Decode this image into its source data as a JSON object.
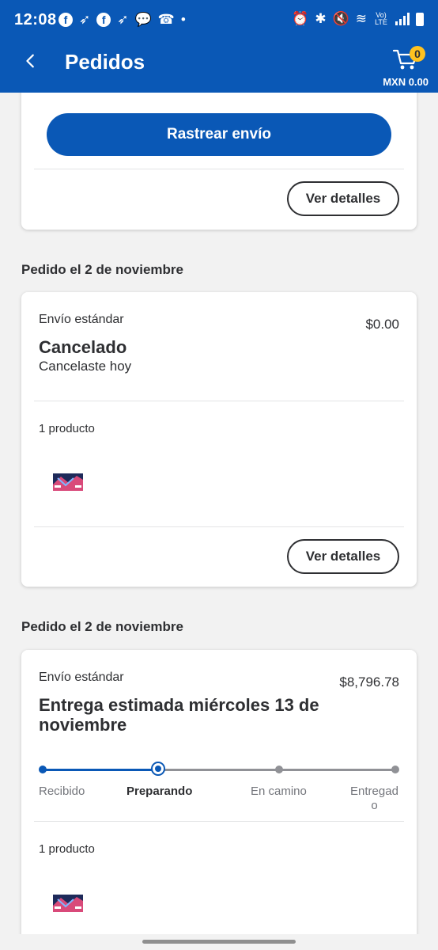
{
  "status_bar": {
    "time": "12:08",
    "network_label": "Vo) LTE"
  },
  "header": {
    "title": "Pedidos",
    "cart_count": "0",
    "cart_amount": "MXN 0.00"
  },
  "top_card": {
    "track_button": "Rastrear envío",
    "details_button": "Ver detalles"
  },
  "orders": [
    {
      "heading": "Pedido el 2 de noviembre",
      "shipping": "Envío estándar",
      "price": "$0.00",
      "status": "Cancelado",
      "status_detail": "Cancelaste hoy",
      "product_count": "1 producto",
      "details_button": "Ver detalles"
    },
    {
      "heading": "Pedido el 2 de noviembre",
      "shipping": "Envío estándar",
      "price": "$8,796.78",
      "status": "Entrega estimada miércoles 13 de noviembre",
      "product_count": "1 producto",
      "tracker": {
        "steps": [
          "Recibido",
          "Preparando",
          "En camino",
          "Entregado"
        ],
        "current_step": 2
      }
    }
  ],
  "colors": {
    "brand_blue": "#0a58b6",
    "badge_yellow": "#ffc220"
  },
  "icons": [
    "back-arrow-icon",
    "cart-icon",
    "facebook-icon",
    "messenger-icon",
    "alarm-icon",
    "bluetooth-icon",
    "mute-icon",
    "wifi-icon",
    "signal-icon",
    "battery-icon"
  ]
}
